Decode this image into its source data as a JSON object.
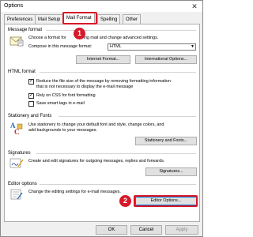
{
  "window": {
    "title": "Options"
  },
  "tabs": [
    {
      "label": "Preferences"
    },
    {
      "label": "Mail Setup"
    },
    {
      "label": "Mail Format"
    },
    {
      "label": "Spelling"
    },
    {
      "label": "Other"
    }
  ],
  "message_format": {
    "heading": "Message format",
    "desc_prefix": "Choose a format for",
    "desc_suffix": "ing mail and change advanced settings.",
    "compose_label": "Compose in this message format:",
    "compose_value": "HTML",
    "internet_format_label": "Internet Format...",
    "international_options_label": "International Options..."
  },
  "html_format": {
    "heading": "HTML format",
    "reduce_line1": "Reduce the file size of the message by removing formatting information",
    "reduce_line2": "that is not necessary to display the e-mail message",
    "rely_css": "Rely on CSS for font formatting",
    "save_smart_tags": "Save smart tags in e-mail"
  },
  "stationery": {
    "heading": "Stationery and Fonts",
    "desc_line1": "Use stationery to change your default font and style, change colors, and",
    "desc_line2": "add backgrounds to your messages.",
    "button": "Stationery and Fonts..."
  },
  "signatures": {
    "heading": "Signatures",
    "desc": "Create and edit signatures for outgoing messages, replies and forwards.",
    "button": "Signatures..."
  },
  "editor_options": {
    "heading": "Editor options",
    "desc": "Change the editing settings for e-mail messages.",
    "button": "Editor Options..."
  },
  "footer": {
    "ok": "OK",
    "cancel": "Cancel",
    "apply": "Apply"
  },
  "annotations": {
    "step1": "1",
    "step2": "2",
    "color": "#d7182a"
  }
}
